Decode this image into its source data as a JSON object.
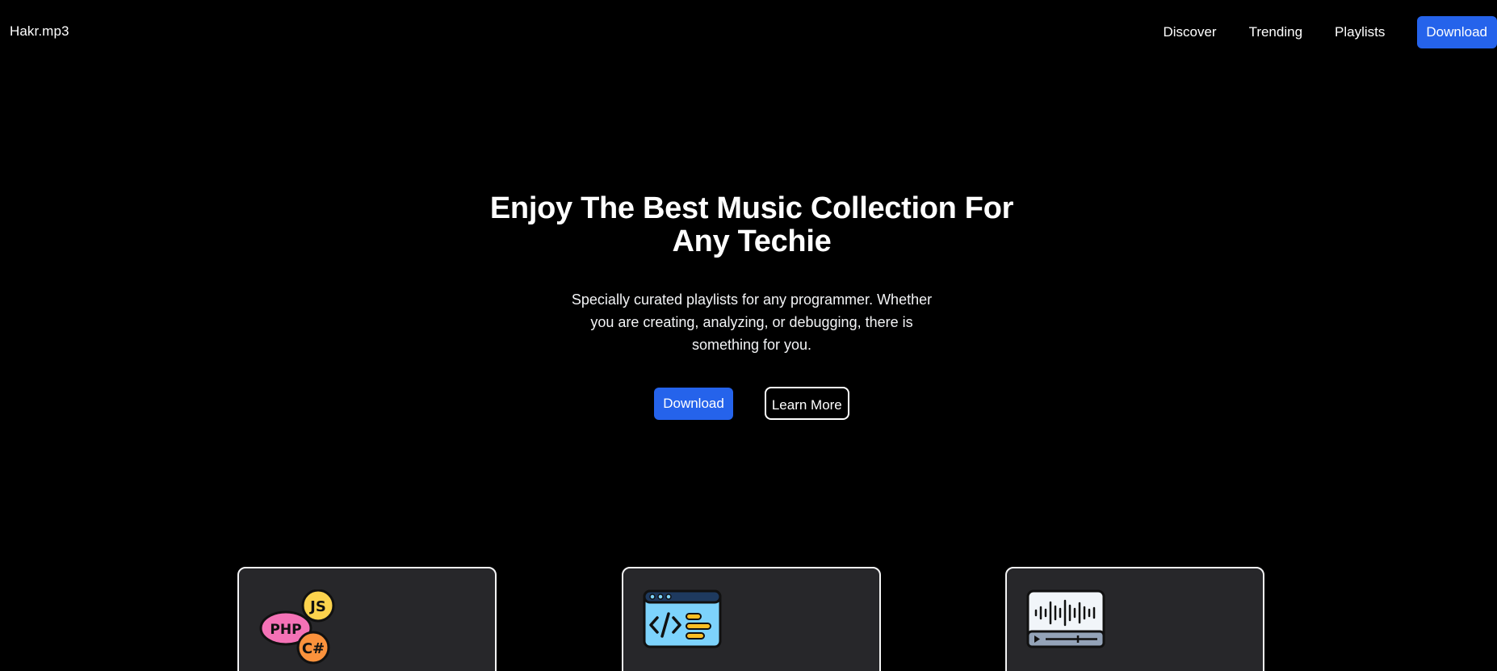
{
  "nav": {
    "logo": "Hakr.mp3",
    "links": [
      "Discover",
      "Trending",
      "Playlists"
    ],
    "download_label": "Download"
  },
  "hero": {
    "title_line1": "Enjoy The Best Music Collection For",
    "title_line2": "Any Techie",
    "subtitle_line1": "Specially curated playlists for any programmer. Whether",
    "subtitle_line2": "you are creating, analyzing, or debugging, there is",
    "subtitle_line3": "something for you.",
    "primary_button": "Download",
    "secondary_button": "Learn More"
  },
  "cards": [
    {
      "icon": "programming-languages-icon",
      "labels": [
        "PHP",
        "JS",
        "C#"
      ]
    },
    {
      "icon": "code-window-icon"
    },
    {
      "icon": "audio-waveform-player-icon"
    }
  ],
  "colors": {
    "background": "#000000",
    "accent": "#2563eb",
    "card_background": "#27272a",
    "card_border": "#f4f4f5"
  }
}
